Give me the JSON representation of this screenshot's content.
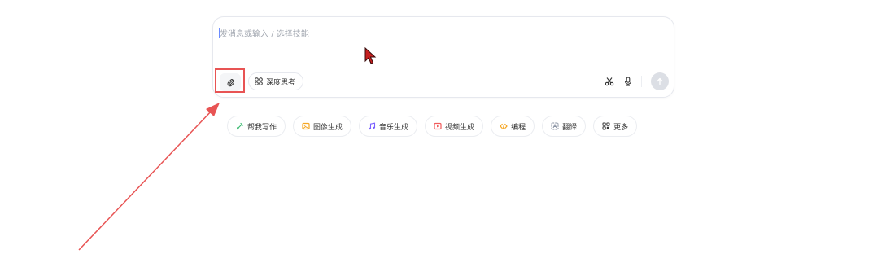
{
  "input": {
    "placeholder": "发消息或输入 / 选择技能",
    "value": ""
  },
  "toolbar": {
    "attach_icon": "paperclip-icon",
    "deep_think_label": "深度思考",
    "deep_think_icon": "grid-icon",
    "scissors_icon": "scissors-icon",
    "mic_icon": "microphone-icon",
    "send_icon": "arrow-up-icon"
  },
  "skills": [
    {
      "label": "帮我写作",
      "icon": "pen-icon",
      "color": "#3dbb72"
    },
    {
      "label": "图像生成",
      "icon": "image-icon",
      "color": "#f5a623"
    },
    {
      "label": "音乐生成",
      "icon": "music-icon",
      "color": "#7b61ff"
    },
    {
      "label": "视频生成",
      "icon": "video-icon",
      "color": "#f15b5b"
    },
    {
      "label": "编程",
      "icon": "code-icon",
      "color": "#f5a623"
    },
    {
      "label": "翻译",
      "icon": "translate-icon",
      "color": "#8a93a3"
    },
    {
      "label": "更多",
      "icon": "more-icon",
      "color": "#333333"
    }
  ],
  "annotation": {
    "highlight_color": "#e85454"
  }
}
